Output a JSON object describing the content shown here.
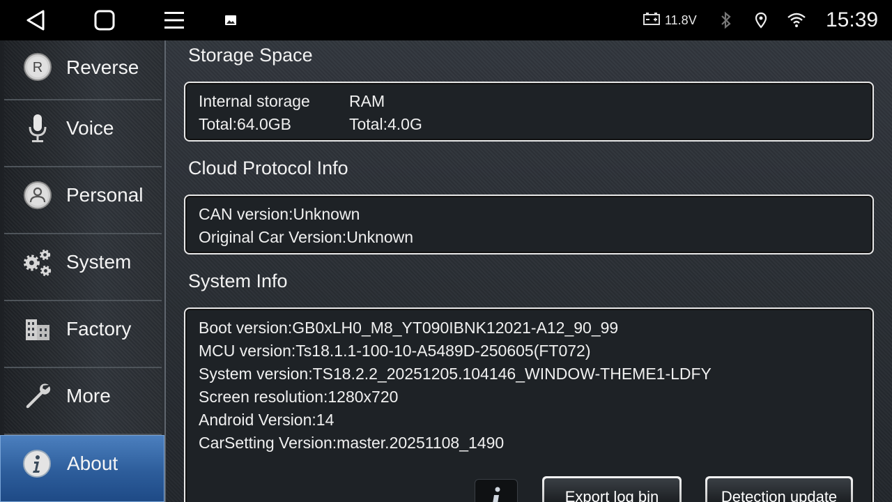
{
  "status_bar": {
    "voltage": "11.8V",
    "time": "15:39",
    "icons": [
      "back-icon",
      "home-icon",
      "menu-icon",
      "image-icon",
      "battery-icon",
      "bluetooth-icon",
      "location-icon",
      "wifi-icon"
    ]
  },
  "sidebar": {
    "items": [
      {
        "label": "Reverse",
        "icon": "reverse-icon"
      },
      {
        "label": "Voice",
        "icon": "microphone-icon"
      },
      {
        "label": "Personal",
        "icon": "person-icon"
      },
      {
        "label": "System",
        "icon": "gears-icon"
      },
      {
        "label": "Factory",
        "icon": "factory-icon"
      },
      {
        "label": "More",
        "icon": "wrench-icon"
      },
      {
        "label": "About",
        "icon": "info-icon",
        "active": true
      }
    ]
  },
  "storage": {
    "title": "Storage Space",
    "internal_label": "Internal storage",
    "internal_total": "Total:64.0GB",
    "ram_label": "RAM",
    "ram_total": "Total:4.0G"
  },
  "cloud": {
    "title": "Cloud Protocol Info",
    "can_version": "CAN version:Unknown",
    "original_car_version": "Original Car Version:Unknown"
  },
  "system_info": {
    "title": "System Info",
    "boot_version": "Boot version:GB0xLH0_M8_YT090IBNK12021-A12_90_99",
    "mcu_version": "MCU version:Ts18.1.1-100-10-A5489D-250605(FT072)",
    "system_version": "System version:TS18.2.2_20251205.104146_WINDOW-THEME1-LDFY",
    "screen_resolution": "Screen resolution:1280x720",
    "android_version": "Android Version:14",
    "carsetting_version": "CarSetting Version:master.20251108_1490"
  },
  "buttons": {
    "export_log": "Export log bin",
    "detection_update": "Detection update"
  },
  "colors": {
    "accent": "#2d5d9b",
    "panel_border": "#e8e8e8"
  }
}
